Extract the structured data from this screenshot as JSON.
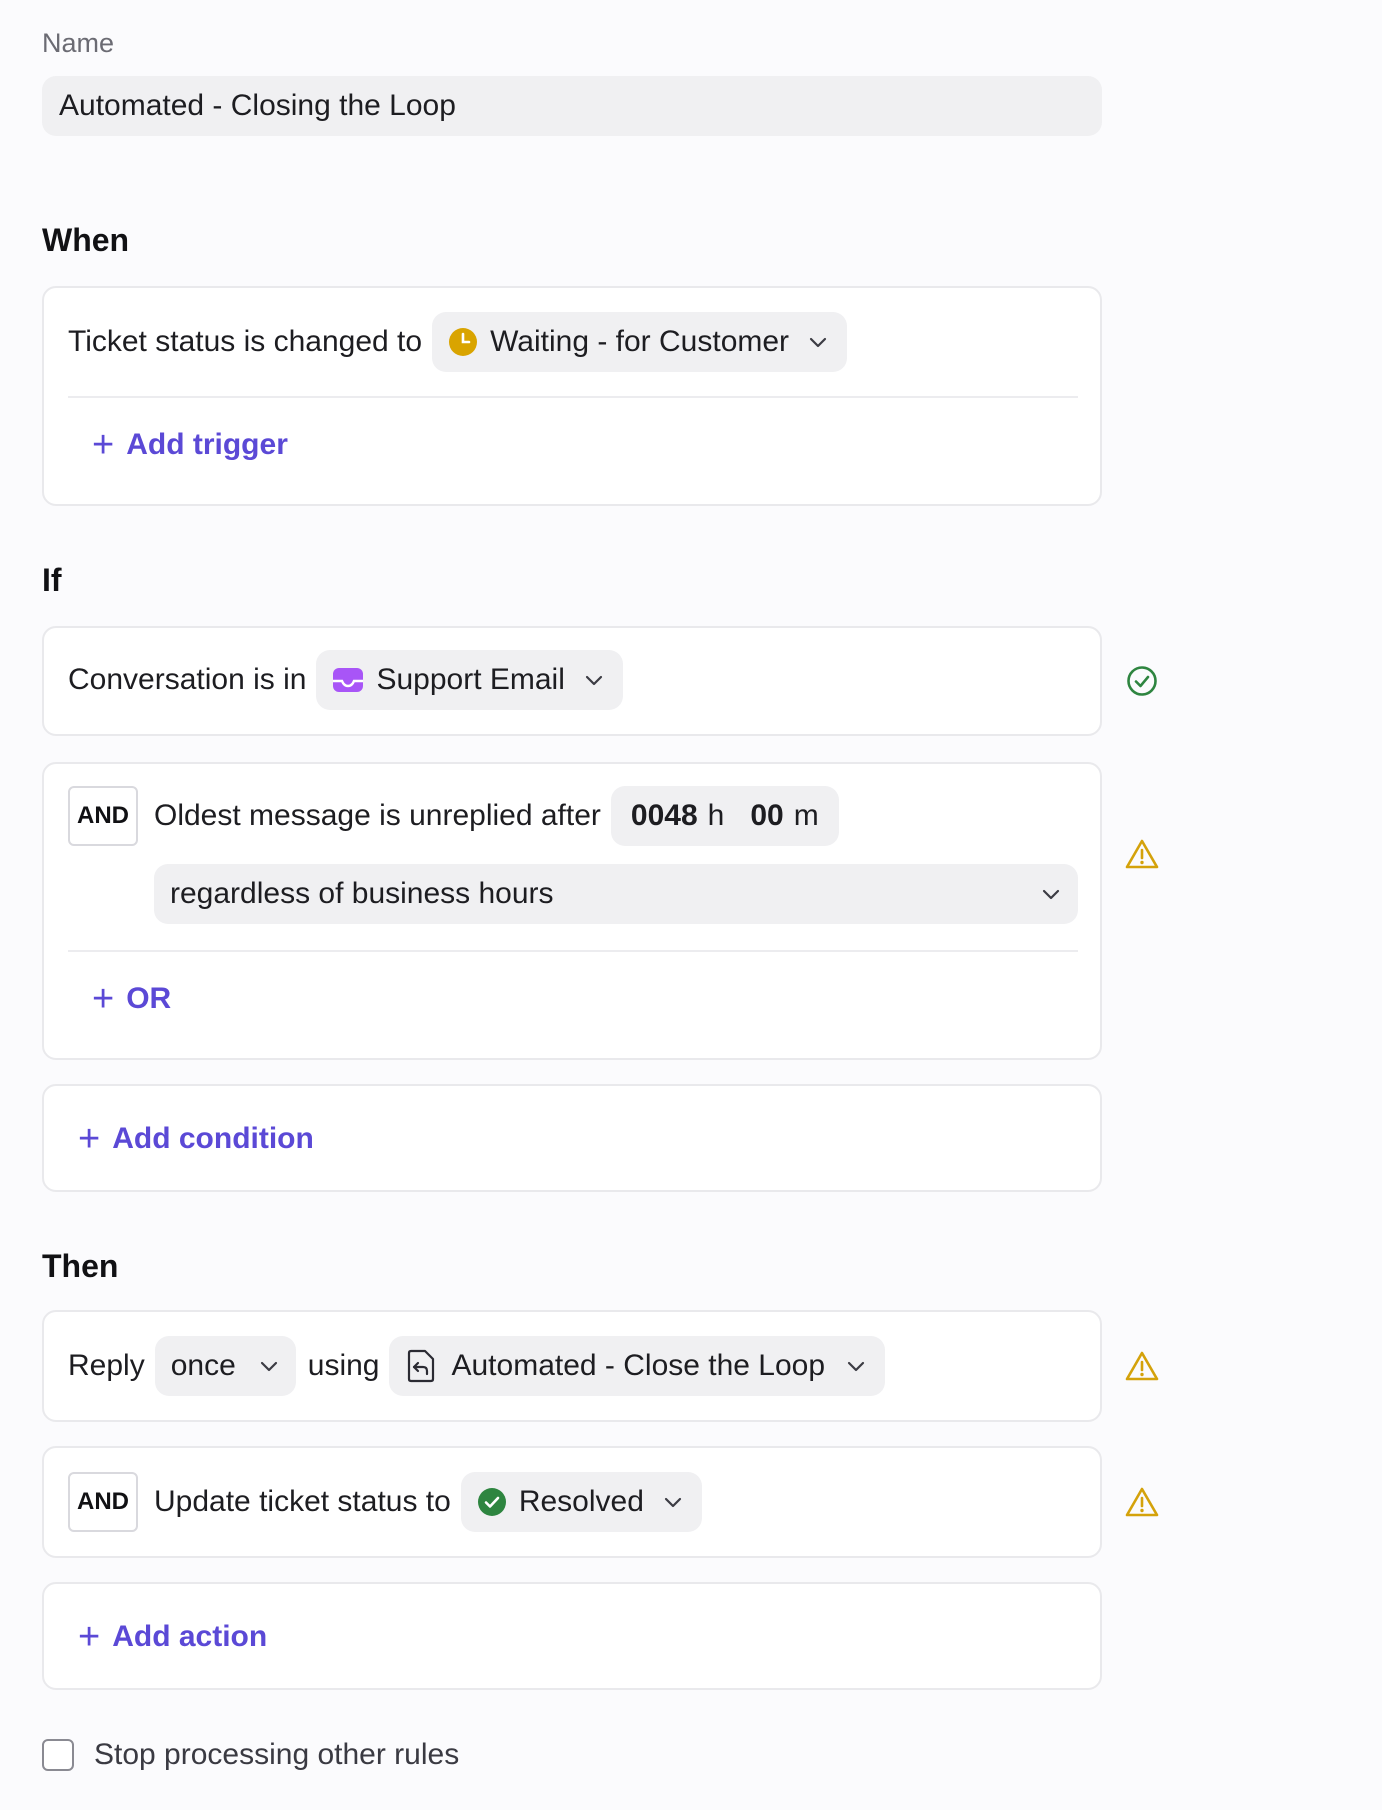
{
  "name_field": {
    "label": "Name",
    "value": "Automated - Closing the Loop"
  },
  "when": {
    "title": "When",
    "trigger_text": "Ticket status is changed to",
    "trigger_value": "Waiting - for Customer",
    "trigger_icon": "clock-icon",
    "trigger_icon_color": "#d9a400",
    "add_trigger": "Add trigger"
  },
  "if": {
    "title": "If",
    "condition1_text": "Conversation is in",
    "condition1_value": "Support Email",
    "condition1_icon": "inbox-icon",
    "condition1_icon_color": "#a855f7",
    "condition1_status": "valid",
    "condition2_and": "AND",
    "condition2_text": "Oldest message is unreplied after",
    "condition2_hours": "0048",
    "condition2_hours_unit": "h",
    "condition2_minutes": "00",
    "condition2_minutes_unit": "m",
    "condition2_hours_mode": "regardless of business hours",
    "condition2_status": "warning",
    "add_or": "OR",
    "add_condition": "Add condition"
  },
  "then": {
    "title": "Then",
    "action1_text": "Reply",
    "action1_frequency": "once",
    "action1_using": "using",
    "action1_template": "Automated - Close the Loop",
    "action1_template_icon": "reply-template-icon",
    "action1_status": "warning",
    "action2_and": "AND",
    "action2_text": "Update ticket status to",
    "action2_value": "Resolved",
    "action2_icon_color": "#2e8540",
    "action2_status": "warning",
    "add_action": "Add action"
  },
  "stop_processing": {
    "label": "Stop processing other rules",
    "checked": false
  },
  "colors": {
    "accent": "#5b49d6",
    "warning": "#d4a20b",
    "success": "#2e8540"
  }
}
